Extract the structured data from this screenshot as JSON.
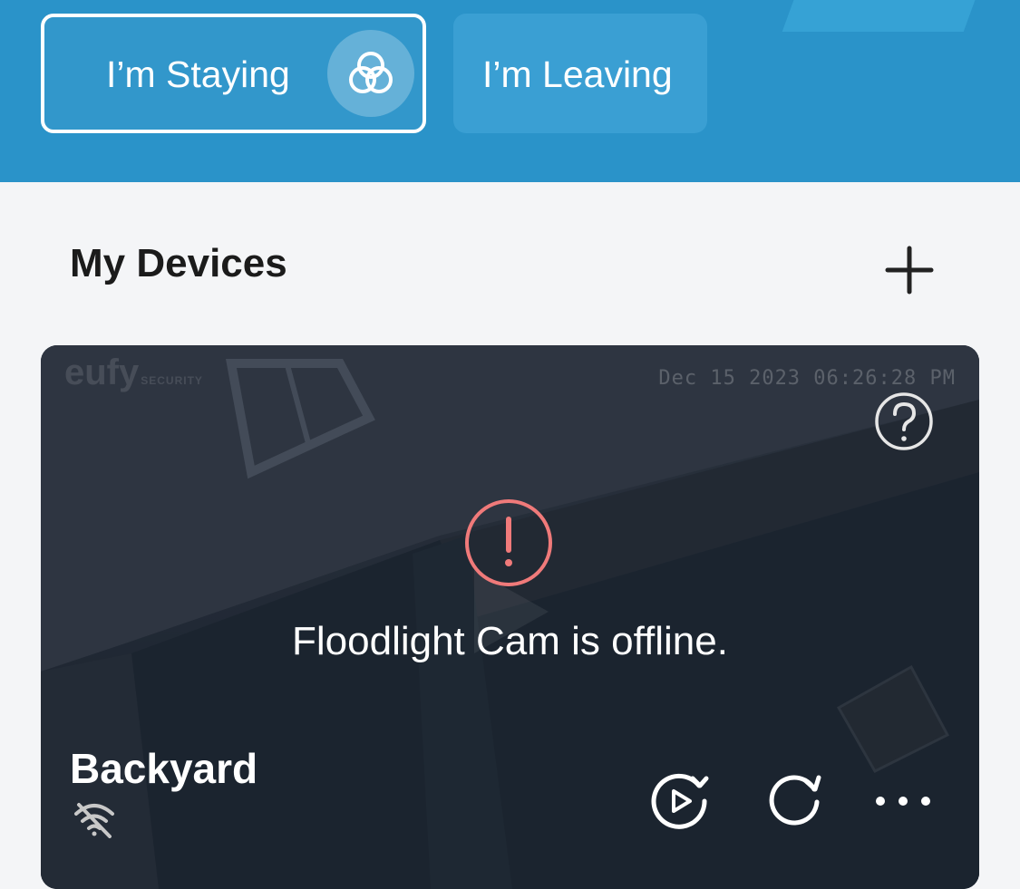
{
  "modes": {
    "staying_label": "I’m Staying",
    "leaving_label": "I’m Leaving"
  },
  "devices_section": {
    "title": "My Devices"
  },
  "device_card": {
    "watermark_brand": "eufy",
    "watermark_sub": "SECURITY",
    "timestamp": "Dec 15 2023  06:26:28 PM",
    "status_message": "Floodlight Cam is offline.",
    "device_name": "Backyard"
  },
  "icons": {
    "staying_badge": "three-circles-icon",
    "add": "plus-icon",
    "help": "question-circle-icon",
    "alert": "exclamation-circle-icon",
    "wifi_off": "wifi-off-icon",
    "playback": "playback-icon",
    "refresh": "refresh-icon",
    "more": "more-dots-icon"
  },
  "colors": {
    "header_blue": "#2a93c9",
    "leaving_button": "#3a9fd3",
    "alert_red": "#f07a7a",
    "page_bg": "#f4f5f7"
  }
}
